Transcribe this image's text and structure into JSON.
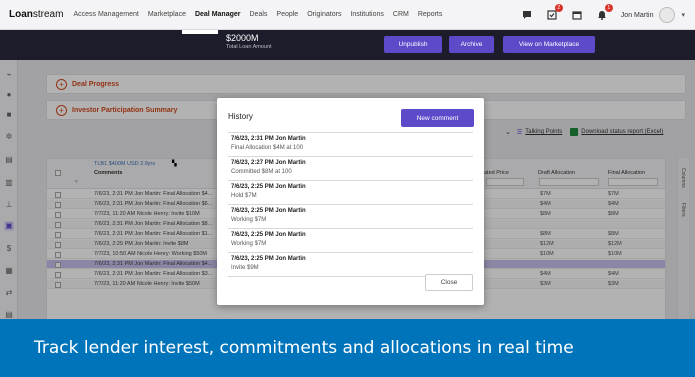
{
  "brand": {
    "bold": "Loan",
    "rest": "stream"
  },
  "nav": {
    "items": [
      "Access Management",
      "Marketplace",
      "Deal Manager",
      "Deals",
      "People",
      "Originators",
      "Institutions",
      "CRM",
      "Reports"
    ],
    "active": "Deal Manager",
    "badge_bell": "1",
    "badge_check": "2",
    "user": "Jon Martin"
  },
  "deal": {
    "amount": "$2000M",
    "amount_label": "Total Loan Amount",
    "unpublish": "Unpublish",
    "archive": "Archive",
    "view_marketplace": "View on Marketplace"
  },
  "panels": {
    "deal_progress": "Deal Progress",
    "investor_summary": "Investor Participation Summary"
  },
  "links": {
    "talking_points": "Talking Points",
    "download_report": "Download status report (Excel)"
  },
  "grid": {
    "tag": "TLB1 $400M USD 2.9yrs",
    "comments_header": "Comments",
    "price_header": "ated Price",
    "draft_header": "Draft Allocation",
    "final_header": "Final Allocation",
    "side_labels": [
      "Columns",
      "Filters"
    ],
    "rows": [
      {
        "comment": "7/6/23, 2:31 PM Jon Martin: Final Allocation $4...",
        "draft": "$7M",
        "final": "$7M"
      },
      {
        "comment": "7/6/23, 2:31 PM Jon Martin: Final Allocation $6...",
        "draft": "$4M",
        "final": "$4M"
      },
      {
        "comment": "7/7/23, 11:20 AM Nicole Henry: Invite $10M",
        "draft": "$8M",
        "final": "$8M"
      },
      {
        "comment": "7/6/23, 2:31 PM Jon Martin: Final Allocation $8...",
        "draft": "",
        "final": ""
      },
      {
        "comment": "7/6/23, 2:31 PM Jon Martin: Final Allocation $1...",
        "draft": "$8M",
        "final": "$8M"
      },
      {
        "comment": "7/6/23, 2:25 PM Jon Martin: Invite $8M",
        "draft": "$12M",
        "final": "$12M"
      },
      {
        "comment": "7/7/23, 10:50 AM Nicole Henry: Working $50M",
        "draft": "$10M",
        "final": "$10M"
      },
      {
        "comment": "7/6/23, 2:31 PM Jon Martin: Final Allocation $4...",
        "draft": "",
        "final": ""
      },
      {
        "comment": "7/6/23, 2:31 PM Jon Martin: Final Allocation $3...",
        "draft": "$4M",
        "final": "$4M"
      },
      {
        "comment": "7/7/23, 11:20 AM Nicole Henry: Invite $50M",
        "draft": "$3M",
        "final": "$3M"
      }
    ]
  },
  "modal": {
    "title": "History",
    "new_comment": "New comment",
    "close": "Close",
    "entries": [
      {
        "meta": "7/6/23, 2:31 PM  Jon Martin",
        "text": "Final Allocation $4M at 100"
      },
      {
        "meta": "7/6/23, 2:27 PM  Jon Martin",
        "text": "Committed $8M at 100"
      },
      {
        "meta": "7/6/23, 2:25 PM  Jon Martin",
        "text": "Hold $7M"
      },
      {
        "meta": "7/6/23, 2:25 PM  Jon Martin",
        "text": "Working $7M"
      },
      {
        "meta": "7/6/23, 2:25 PM  Jon Martin",
        "text": "Working $7M"
      },
      {
        "meta": "7/6/23, 2:25 PM  Jon Martin",
        "text": "Invite $9M"
      }
    ]
  },
  "caption": "Track lender interest, commitments and allocations in real time",
  "colors": {
    "accent": "#5b4bc9",
    "caption_bg": "#0074ba",
    "link_orange": "#d24a1f",
    "dark_bar": "#1c1c2a"
  }
}
